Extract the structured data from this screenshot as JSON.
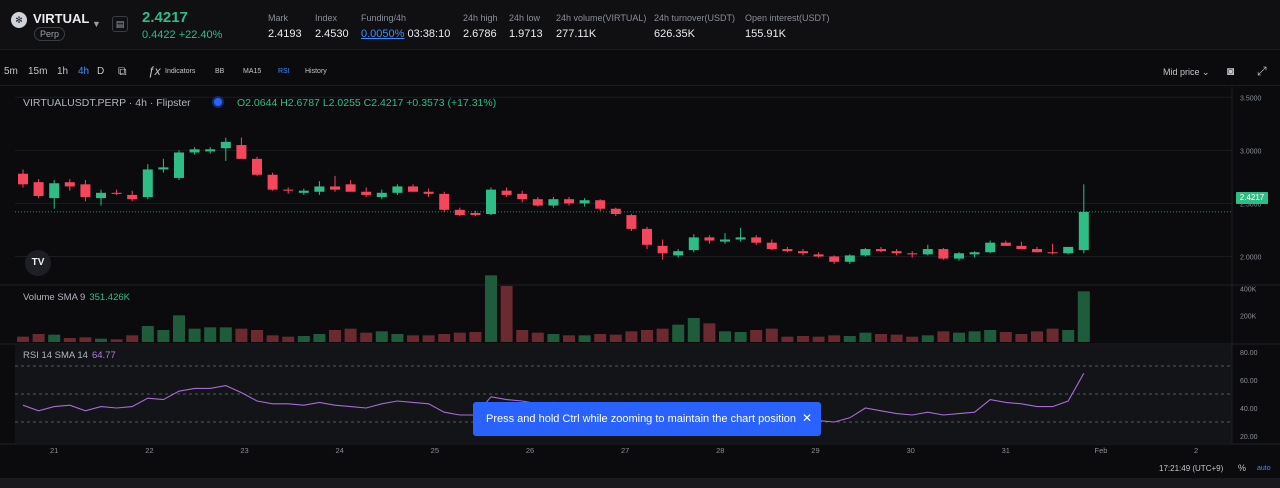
{
  "header": {
    "pair": "VIRTUAL",
    "tag": "Perp",
    "last_price": "2.4217",
    "change": "0.4422 +22.40%",
    "stats": [
      {
        "label": "Mark",
        "value": "2.4193"
      },
      {
        "label": "Index",
        "value": "2.4530"
      },
      {
        "label": "Funding/4h",
        "value": "0.0050%",
        "extra": "03:38:10"
      },
      {
        "label": "24h high",
        "value": "2.6786"
      },
      {
        "label": "24h low",
        "value": "1.9713"
      },
      {
        "label": "24h volume(VIRTUAL)",
        "value": "277.11K"
      },
      {
        "label": "24h turnover(USDT)",
        "value": "626.35K"
      },
      {
        "label": "Open interest(USDT)",
        "value": "155.91K"
      }
    ]
  },
  "toolbar": {
    "intervals": [
      "5m",
      "15m",
      "1h",
      "4h",
      "D"
    ],
    "active_interval": "4h",
    "indicators": "Indicators",
    "bb": "BB",
    "ma15": "MA15",
    "rsi": "RSI",
    "history": "History",
    "price_mode": "Mid price"
  },
  "chart": {
    "symbol_line": "VIRTUALUSDT.PERP · 4h · Flipster",
    "ohlc": "O2.0644  H2.6787  L2.0255  C2.4217  +0.3573 (+17.31%)",
    "current_price": "2.4217",
    "price_ticks": [
      "3.5000",
      "3.0000",
      "2.5000",
      "2.0000"
    ],
    "volume_ticks": [
      "400K",
      "200K"
    ],
    "rsi_ticks": [
      "80.00",
      "60.00",
      "40.00",
      "20.00"
    ],
    "date_labels": [
      "21",
      "22",
      "23",
      "24",
      "25",
      "26",
      "27",
      "28",
      "29",
      "30",
      "31",
      "Feb",
      "2"
    ],
    "volume_legend": {
      "name": "Volume SMA 9",
      "value": "351.426K"
    },
    "rsi_legend": {
      "name": "RSI 14 SMA 14",
      "value": "64.77"
    },
    "logo": "TV"
  },
  "chart_data": {
    "type": "candlestick",
    "timeframe": "4h",
    "ohlc": [
      [
        2.78,
        2.82,
        2.65,
        2.68
      ],
      [
        2.7,
        2.73,
        2.55,
        2.57
      ],
      [
        2.55,
        2.72,
        2.45,
        2.69
      ],
      [
        2.7,
        2.73,
        2.62,
        2.66
      ],
      [
        2.68,
        2.72,
        2.52,
        2.56
      ],
      [
        2.55,
        2.63,
        2.48,
        2.6
      ],
      [
        2.6,
        2.63,
        2.58,
        2.59
      ],
      [
        2.58,
        2.62,
        2.52,
        2.54
      ],
      [
        2.56,
        2.87,
        2.54,
        2.82
      ],
      [
        2.82,
        2.92,
        2.79,
        2.84
      ],
      [
        2.74,
        3.0,
        2.72,
        2.98
      ],
      [
        2.98,
        3.03,
        2.96,
        3.01
      ],
      [
        2.99,
        3.03,
        2.97,
        3.01
      ],
      [
        3.02,
        3.12,
        2.9,
        3.08
      ],
      [
        3.05,
        3.12,
        2.93,
        2.92
      ],
      [
        2.92,
        2.94,
        2.76,
        2.77
      ],
      [
        2.77,
        2.79,
        2.62,
        2.63
      ],
      [
        2.63,
        2.65,
        2.59,
        2.62
      ],
      [
        2.6,
        2.64,
        2.58,
        2.62
      ],
      [
        2.61,
        2.71,
        2.58,
        2.66
      ],
      [
        2.66,
        2.76,
        2.61,
        2.63
      ],
      [
        2.68,
        2.72,
        2.63,
        2.61
      ],
      [
        2.61,
        2.65,
        2.56,
        2.58
      ],
      [
        2.56,
        2.63,
        2.54,
        2.6
      ],
      [
        2.6,
        2.68,
        2.58,
        2.66
      ],
      [
        2.66,
        2.68,
        2.61,
        2.61
      ],
      [
        2.61,
        2.64,
        2.56,
        2.59
      ],
      [
        2.59,
        2.61,
        2.42,
        2.44
      ],
      [
        2.44,
        2.46,
        2.38,
        2.39
      ],
      [
        2.41,
        2.43,
        2.38,
        2.39
      ],
      [
        2.4,
        2.65,
        2.39,
        2.63
      ],
      [
        2.62,
        2.65,
        2.56,
        2.58
      ],
      [
        2.59,
        2.62,
        2.51,
        2.54
      ],
      [
        2.54,
        2.56,
        2.47,
        2.48
      ],
      [
        2.48,
        2.56,
        2.46,
        2.54
      ],
      [
        2.54,
        2.56,
        2.48,
        2.5
      ],
      [
        2.5,
        2.55,
        2.47,
        2.53
      ],
      [
        2.53,
        2.54,
        2.43,
        2.45
      ],
      [
        2.45,
        2.46,
        2.38,
        2.4
      ],
      [
        2.39,
        2.4,
        2.24,
        2.26
      ],
      [
        2.26,
        2.28,
        2.07,
        2.11
      ],
      [
        2.1,
        2.16,
        1.97,
        2.03
      ],
      [
        2.01,
        2.07,
        1.99,
        2.05
      ],
      [
        2.06,
        2.21,
        2.04,
        2.18
      ],
      [
        2.18,
        2.2,
        2.12,
        2.15
      ],
      [
        2.14,
        2.22,
        2.12,
        2.16
      ],
      [
        2.16,
        2.27,
        2.14,
        2.18
      ],
      [
        2.18,
        2.2,
        2.11,
        2.13
      ],
      [
        2.13,
        2.16,
        2.06,
        2.07
      ],
      [
        2.07,
        2.09,
        2.04,
        2.05
      ],
      [
        2.05,
        2.07,
        2.01,
        2.03
      ],
      [
        2.02,
        2.04,
        1.99,
        2.0
      ],
      [
        2.0,
        2.01,
        1.93,
        1.95
      ],
      [
        1.95,
        2.02,
        1.93,
        2.01
      ],
      [
        2.01,
        2.08,
        2.0,
        2.07
      ],
      [
        2.07,
        2.09,
        2.04,
        2.05
      ],
      [
        2.05,
        2.07,
        2.01,
        2.03
      ],
      [
        2.03,
        2.05,
        1.99,
        2.02
      ],
      [
        2.02,
        2.11,
        2.01,
        2.07
      ],
      [
        2.07,
        2.08,
        1.97,
        1.98
      ],
      [
        1.98,
        2.04,
        1.96,
        2.03
      ],
      [
        2.02,
        2.05,
        1.99,
        2.04
      ],
      [
        2.04,
        2.15,
        2.03,
        2.13
      ],
      [
        2.13,
        2.15,
        2.1,
        2.1
      ],
      [
        2.1,
        2.14,
        2.07,
        2.07
      ],
      [
        2.07,
        2.09,
        2.04,
        2.04
      ],
      [
        2.04,
        2.12,
        2.02,
        2.03
      ],
      [
        2.03,
        2.08,
        2.02,
        2.09
      ],
      [
        2.06,
        2.68,
        2.03,
        2.42
      ]
    ],
    "volume": [
      40,
      60,
      55,
      30,
      35,
      25,
      20,
      50,
      120,
      90,
      200,
      100,
      110,
      110,
      100,
      90,
      50,
      40,
      45,
      60,
      90,
      100,
      70,
      80,
      60,
      50,
      50,
      60,
      70,
      75,
      500,
      420,
      90,
      70,
      60,
      50,
      50,
      60,
      55,
      80,
      90,
      100,
      130,
      180,
      140,
      80,
      75,
      90,
      100,
      40,
      45,
      40,
      50,
      45,
      70,
      60,
      55,
      40,
      50,
      80,
      70,
      80,
      90,
      75,
      60,
      80,
      100,
      90,
      380
    ],
    "rsi": [
      42,
      38,
      41,
      42,
      38,
      41,
      40,
      41,
      47,
      46,
      52,
      54,
      54,
      56,
      51,
      45,
      43,
      43,
      42,
      44,
      42,
      41,
      40,
      43,
      45,
      44,
      43,
      37,
      35,
      35,
      48,
      46,
      45,
      43,
      44,
      43,
      44,
      42,
      40,
      35,
      30,
      30,
      31,
      38,
      36,
      36,
      38,
      36,
      34,
      33,
      32,
      31,
      30,
      33,
      40,
      38,
      36,
      35,
      37,
      35,
      36,
      37,
      46,
      44,
      43,
      41,
      41,
      45,
      64.77
    ],
    "price_range": [
      1.75,
      3.55
    ],
    "volume_range": [
      0,
      420
    ],
    "rsi_range": [
      15,
      85
    ],
    "rsi_levels": [
      70,
      50,
      30
    ]
  },
  "toast": {
    "text": "Press and hold Ctrl while zooming to maintain the chart position",
    "close": "✕"
  },
  "footer": {
    "time": "17:21:49 (UTC+9)",
    "pct": "%",
    "auto": "auto"
  }
}
